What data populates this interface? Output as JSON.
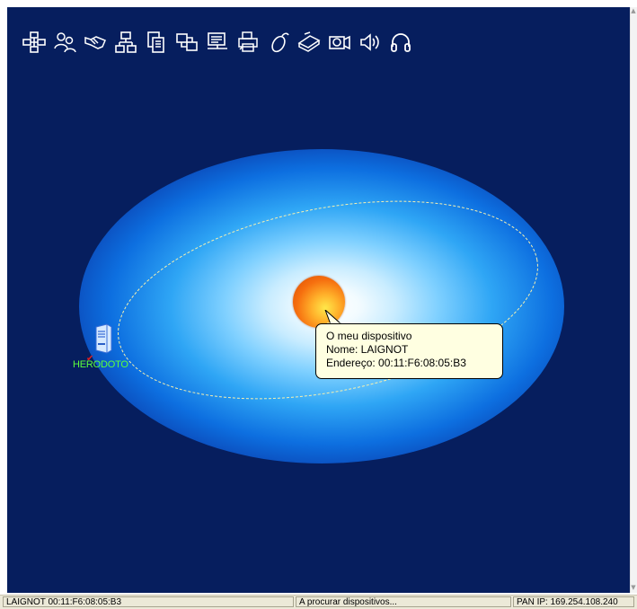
{
  "toolbar": {
    "icons": [
      "network-icon",
      "people-icon",
      "handshake-icon",
      "lan-icon",
      "document-transfer-icon",
      "serial-port-icon",
      "fax-icon",
      "printer-icon",
      "mouse-icon",
      "scanner-icon",
      "camera-icon",
      "audio-icon",
      "headset-icon"
    ]
  },
  "center_device": {
    "tooltip": {
      "line1": "O meu dispositivo",
      "line2": "Nome: LAIGNOT",
      "line3": "Endereço: 00:11:F6:08:05:B3"
    }
  },
  "remote_device": {
    "label": "HERODOTO"
  },
  "status_bar": {
    "device": "LAIGNOT 00:11:F6:08:05:B3",
    "activity": "A procurar dispositivos...",
    "pan_ip": "PAN IP: 169.254.108.240"
  },
  "colors": {
    "background": "#061e5e",
    "tooltip_bg": "#ffffe1",
    "device_label": "#5cff3c"
  }
}
